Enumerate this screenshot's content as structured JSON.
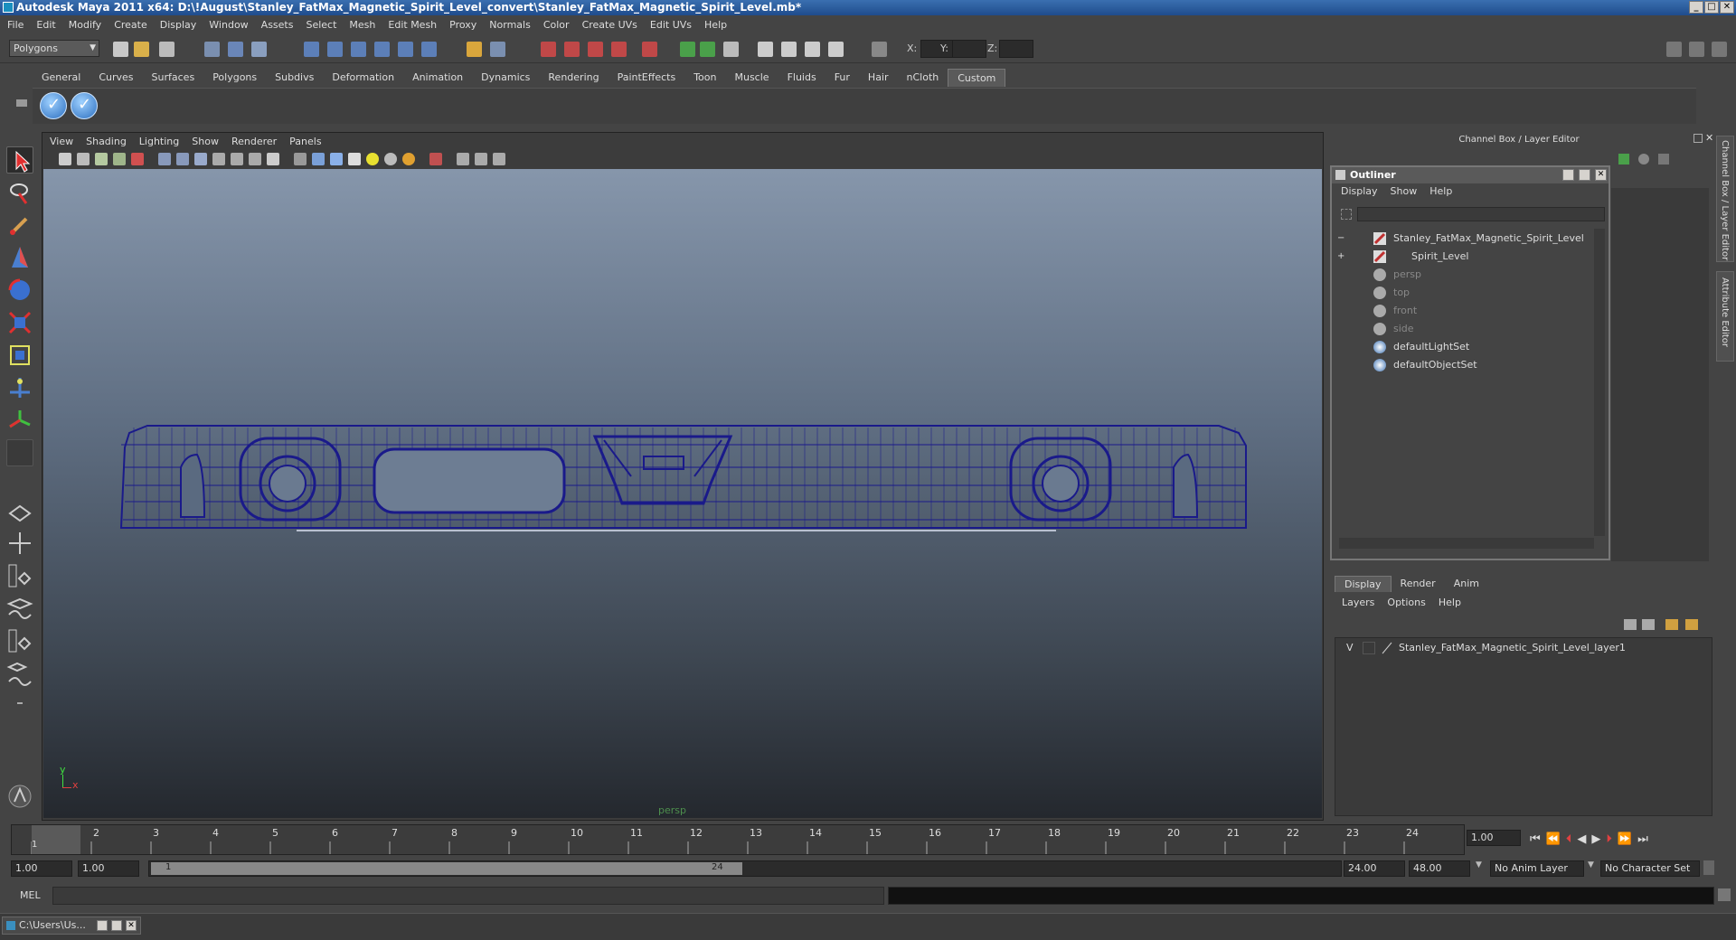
{
  "window": {
    "title": "Autodesk Maya 2011 x64: D:\\!August\\Stanley_FatMax_Magnetic_Spirit_Level_convert\\Stanley_FatMax_Magnetic_Spirit_Level.mb*",
    "min": "_",
    "max": "□",
    "close": "✕"
  },
  "menubar": [
    "File",
    "Edit",
    "Modify",
    "Create",
    "Display",
    "Window",
    "Assets",
    "Select",
    "Mesh",
    "Edit Mesh",
    "Proxy",
    "Normals",
    "Color",
    "Create UVs",
    "Edit UVs",
    "Help"
  ],
  "statusline": {
    "mode": "Polygons",
    "x_label": "X:",
    "y_label": "Y:",
    "z_label": "Z:"
  },
  "shelf": {
    "tabs": [
      "General",
      "Curves",
      "Surfaces",
      "Polygons",
      "Subdivs",
      "Deformation",
      "Animation",
      "Dynamics",
      "Rendering",
      "PaintEffects",
      "Toon",
      "Muscle",
      "Fluids",
      "Fur",
      "Hair",
      "nCloth",
      "Custom"
    ],
    "active_tab": "Custom"
  },
  "viewport": {
    "menu": [
      "View",
      "Shading",
      "Lighting",
      "Show",
      "Renderer",
      "Panels"
    ],
    "camera": "persp",
    "axis_y": "y",
    "axis_x": "x"
  },
  "channel_box": {
    "title": "Channel Box / Layer Editor",
    "side_tab1": "Channel Box / Layer Editor",
    "side_tab2": "Attribute Editor"
  },
  "outliner": {
    "title": "Outliner",
    "menu": [
      "Display",
      "Show",
      "Help"
    ],
    "items": [
      {
        "label": "Stanley_FatMax_Magnetic_Spirit_Level",
        "expander": "−",
        "dim": false
      },
      {
        "label": "Spirit_Level",
        "expander": "+",
        "dim": false
      },
      {
        "label": "persp",
        "dim": true
      },
      {
        "label": "top",
        "dim": true
      },
      {
        "label": "front",
        "dim": true
      },
      {
        "label": "side",
        "dim": true
      },
      {
        "label": "defaultLightSet",
        "dim": false
      },
      {
        "label": "defaultObjectSet",
        "dim": false
      }
    ]
  },
  "layer_editor": {
    "tabs": [
      "Display",
      "Render",
      "Anim"
    ],
    "active_tab": "Display",
    "menu": [
      "Layers",
      "Options",
      "Help"
    ],
    "layer": {
      "visible": "V",
      "name": "Stanley_FatMax_Magnetic_Spirit_Level_layer1"
    }
  },
  "timeline": {
    "ticks": [
      "1",
      "2",
      "3",
      "4",
      "5",
      "6",
      "7",
      "8",
      "9",
      "10",
      "11",
      "12",
      "13",
      "14",
      "15",
      "16",
      "17",
      "18",
      "19",
      "20",
      "21",
      "22",
      "23",
      "24"
    ],
    "current_frame_label": "1",
    "current_time": "1.00"
  },
  "range": {
    "start_time": "1.00",
    "playback_start": "1.00",
    "slider_start": "1",
    "slider_end": "24",
    "playback_end": "24.00",
    "end_time": "48.00",
    "anim_layer": "No Anim Layer",
    "char_set": "No Character Set"
  },
  "command_line": {
    "label": "MEL"
  },
  "taskbar": {
    "item": "C:\\Users\\Us..."
  }
}
